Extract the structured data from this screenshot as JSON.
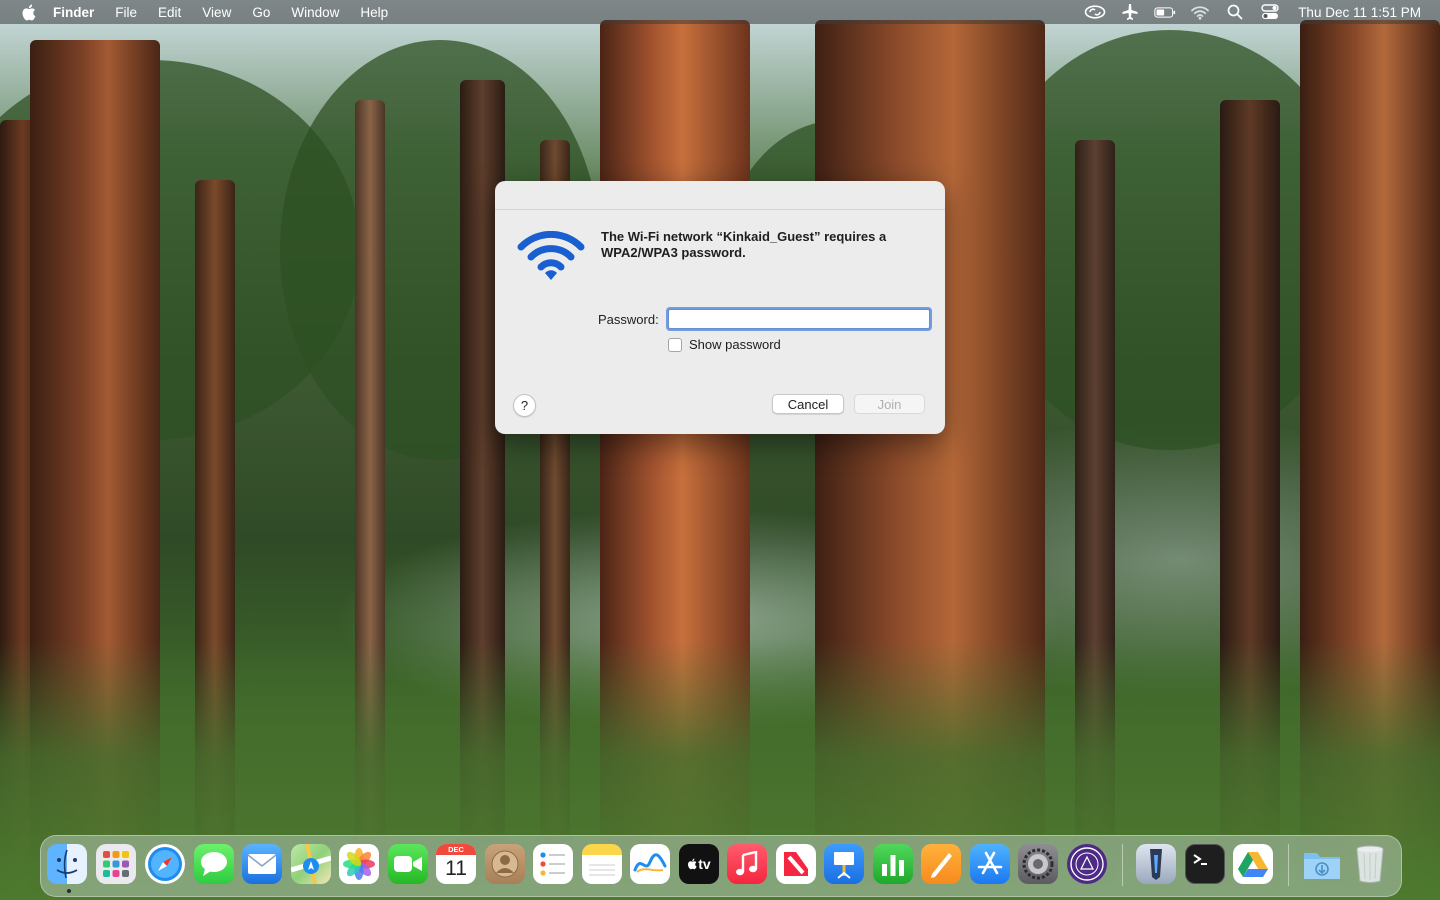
{
  "menubar": {
    "app_name": "Finder",
    "menus": [
      "File",
      "Edit",
      "View",
      "Go",
      "Window",
      "Help"
    ],
    "clock": "Thu Dec 11  1:51 PM",
    "status_icons": [
      "creative-cloud-icon",
      "airplane-icon",
      "battery-icon",
      "wifi-icon",
      "spotlight-search-icon",
      "control-center-icon"
    ]
  },
  "dialog": {
    "message": "The Wi-Fi network “Kinkaid_Guest” requires a WPA2/WPA3 password.",
    "password_label": "Password:",
    "password_value": "",
    "show_password_label": "Show password",
    "help_label": "?",
    "cancel_label": "Cancel",
    "join_label": "Join"
  },
  "dock": {
    "calendar_month": "DEC",
    "calendar_day": "11",
    "appletv_label": "tv",
    "apps": [
      "Finder",
      "Launchpad",
      "Safari",
      "Messages",
      "Mail",
      "Maps",
      "Photos",
      "FaceTime",
      "Calendar",
      "Contacts",
      "Reminders",
      "Notes",
      "Freeform",
      "Apple TV",
      "Music",
      "News",
      "Keynote",
      "Numbers",
      "Pages",
      "App Store",
      "System Settings",
      "School App",
      "Xcode",
      "Terminal",
      "Google Drive",
      "Downloads",
      "Trash"
    ]
  },
  "colors": {
    "accent_blue": "#1a5fd0",
    "focus_ring": "#4a80dc",
    "dialog_bg": "#ececec"
  }
}
